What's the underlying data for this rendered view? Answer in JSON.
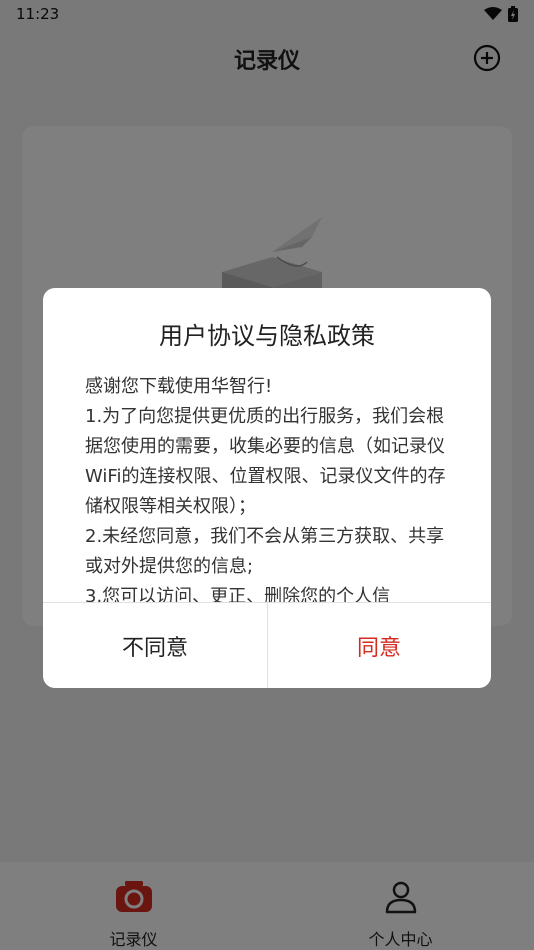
{
  "status_bar": {
    "time": "11:23"
  },
  "header": {
    "title": "记录仪"
  },
  "bottom_nav": {
    "items": [
      {
        "label": "记录仪",
        "icon": "camera-icon"
      },
      {
        "label": "个人中心",
        "icon": "person-icon"
      }
    ]
  },
  "dialog": {
    "title": "用户协议与隐私政策",
    "paragraphs": [
      "感谢您下载使用华智行!",
      "1.为了向您提供更优质的出行服务，我们会根据您使用的需要，收集必要的信息（如记录仪WiFi的连接权限、位置权限、记录仪文件的存储权限等相关权限）；",
      "2.未经您同意，我们不会从第三方获取、共享或对外提供您的信息;",
      "3.您可以访问、更正、删除您的个人信"
    ],
    "disagree_label": "不同意",
    "agree_label": "同意"
  },
  "colors": {
    "accent": "#d42a1f",
    "overlay": "rgba(0,0,0,0.5)"
  }
}
